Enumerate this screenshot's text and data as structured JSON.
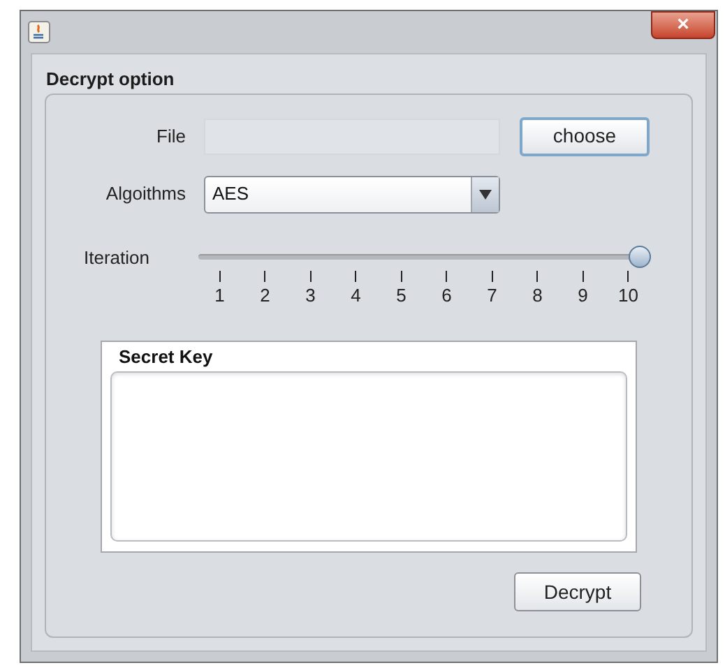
{
  "window": {
    "close": "×"
  },
  "group": {
    "title": "Decrypt option"
  },
  "file": {
    "label": "File",
    "button": "choose"
  },
  "algorithm": {
    "label": "Algoithms",
    "value": "AES"
  },
  "iteration": {
    "label": "Iteration",
    "level": 1.0,
    "ticks": [
      "1",
      "2",
      "3",
      "4",
      "5",
      "6",
      "7",
      "8",
      "9",
      "10"
    ]
  },
  "secret_key": {
    "title": "Secret Key"
  },
  "decrypt_button": "Decrypt"
}
